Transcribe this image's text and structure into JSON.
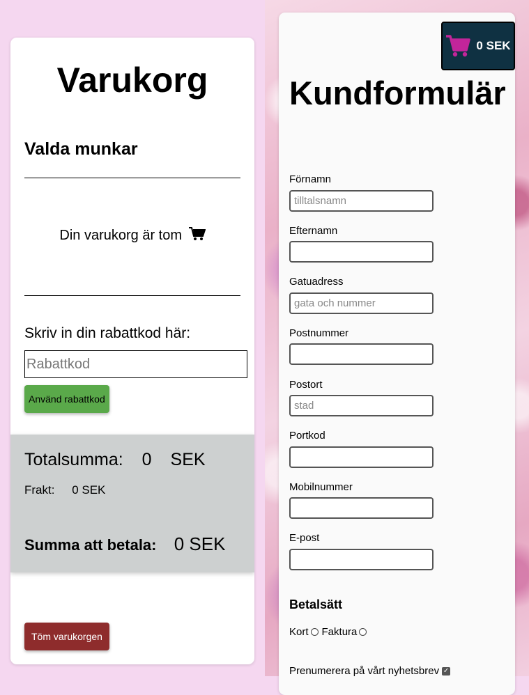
{
  "cart": {
    "title": "Varukorg",
    "selected_heading": "Valda munkar",
    "empty_message": "Din varukorg är tom",
    "discount_label": "Skriv in din rabattkod här:",
    "discount_placeholder": "Rabattkod",
    "apply_discount_label": "Använd rabattkod",
    "total_label": "Totalsumma:",
    "total_value": "0",
    "total_currency": "SEK",
    "shipping_label": "Frakt:",
    "shipping_value": "0 SEK",
    "pay_label": "Summa att betala:",
    "pay_value": "0 SEK",
    "empty_cart_label": "Töm varukorgen"
  },
  "header_cart": {
    "amount": "0 SEK"
  },
  "form": {
    "title": "Kundformulär",
    "fields": [
      {
        "label": "Förnamn",
        "placeholder": "tilltalsnamn"
      },
      {
        "label": "Efternamn",
        "placeholder": ""
      },
      {
        "label": "Gatuadress",
        "placeholder": "gata och nummer"
      },
      {
        "label": "Postnummer",
        "placeholder": ""
      },
      {
        "label": "Postort",
        "placeholder": "stad"
      },
      {
        "label": "Portkod",
        "placeholder": ""
      },
      {
        "label": "Mobilnummer",
        "placeholder": ""
      },
      {
        "label": "E-post",
        "placeholder": ""
      }
    ],
    "payment_heading": "Betalsätt",
    "payment_options": [
      "Kort",
      "Faktura"
    ],
    "newsletter_label": "Prenumerera på vårt nyhetsbrev"
  },
  "colors": {
    "page_bg": "#f5d7f0",
    "apply_button": "#5aa94a",
    "empty_button": "#8e2c2c",
    "summary_bg": "#cdd0d0",
    "cart_button_bg": "#0f3142",
    "cart_icon": "#c2259a"
  },
  "icons": {
    "empty_cart": "shopping-cart-icon",
    "header_cart": "shopping-cart-icon"
  }
}
